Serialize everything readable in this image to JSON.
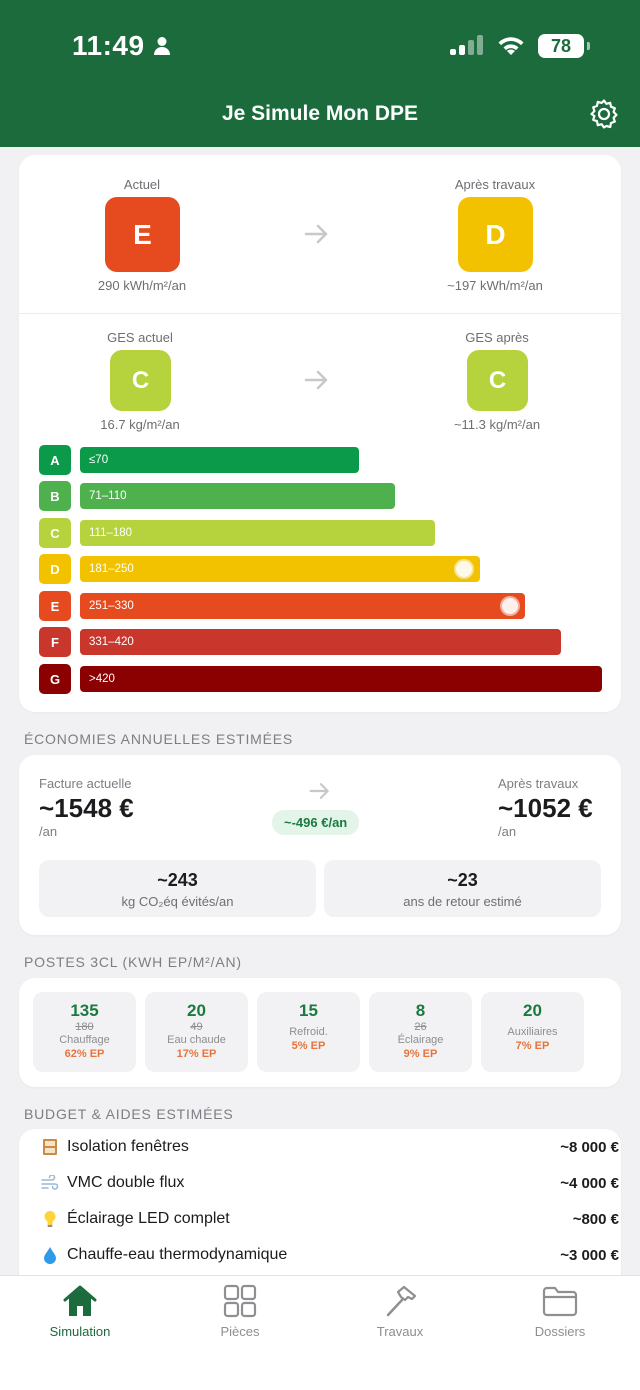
{
  "status_bar": {
    "time": "11:49",
    "battery": "78"
  },
  "header": {
    "title": "Je Simule Mon DPE",
    "settings_icon": "gear-icon"
  },
  "dpe": {
    "current_label": "Actuel",
    "current_class": "E",
    "current_value": "290 kWh/m²/an",
    "after_label": "Après travaux",
    "after_class": "D",
    "after_value": "~197 kWh/m²/an",
    "ges_current_label": "GES actuel",
    "ges_current_class": "C",
    "ges_current_value": "16.7 kg/m²/an",
    "ges_after_label": "GES après",
    "ges_after_class": "C",
    "ges_after_value": "~11.3 kg/m²/an",
    "colors": {
      "E": "#e64a1f",
      "D": "#f2c200",
      "C": "#b6d23c"
    }
  },
  "scale": [
    {
      "letter": "A",
      "range": "≤70",
      "color": "#0b9a4a",
      "fill": 0.5
    },
    {
      "letter": "B",
      "range": "71–110",
      "color": "#4fb14e",
      "fill": 0.56
    },
    {
      "letter": "C",
      "range": "111–180",
      "color": "#b6d23c",
      "fill": 0.63
    },
    {
      "letter": "D",
      "range": "181–250",
      "color": "#f2c200",
      "fill": 0.71
    },
    {
      "letter": "E",
      "range": "251–330",
      "color": "#e64a1f",
      "fill": 0.79
    },
    {
      "letter": "F",
      "range": "331–420",
      "color": "#c9372c",
      "fill": 0.86
    },
    {
      "letter": "G",
      "range": ">420",
      "color": "#8b0000",
      "fill": 0.93
    }
  ],
  "savings": {
    "section_title": "ÉCONOMIES ANNUELLES ESTIMÉES",
    "current_label": "Facture actuelle",
    "current_value": "~1548 €",
    "current_unit": "/an",
    "after_label": "Après travaux",
    "after_value": "~1052 €",
    "after_unit": "/an",
    "delta": "~-496 €/an",
    "co2_value": "~243",
    "co2_label": "kg CO₂éq évités/an",
    "payback_value": "~23",
    "payback_label": "ans de retour estimé"
  },
  "postes": {
    "section_title": "POSTES 3CL (KWH EP/M²/AN)",
    "items": [
      {
        "value": "135",
        "old": "180",
        "name": "Chauffage",
        "ep": "62% EP"
      },
      {
        "value": "20",
        "old": "49",
        "name": "Eau chaude",
        "ep": "17% EP"
      },
      {
        "value": "15",
        "old": "",
        "name": "Refroid.",
        "ep": "5% EP"
      },
      {
        "value": "8",
        "old": "26",
        "name": "Éclairage",
        "ep": "9% EP"
      },
      {
        "value": "20",
        "old": "",
        "name": "Auxiliaires",
        "ep": "7% EP"
      }
    ]
  },
  "budget": {
    "section_title": "BUDGET & AIDES ESTIMÉES",
    "items": [
      {
        "icon": "window-icon",
        "label": "Isolation fenêtres",
        "price": "~8 000 €"
      },
      {
        "icon": "wind-icon",
        "label": "VMC double flux",
        "price": "~4 000 €"
      },
      {
        "icon": "lightbulb-icon",
        "label": "Éclairage LED complet",
        "price": "~800 €"
      },
      {
        "icon": "droplet-icon",
        "label": "Chauffe-eau thermodynamique",
        "price": "~3 000 €"
      }
    ]
  },
  "tabs": [
    {
      "label": "Simulation",
      "icon": "house-icon",
      "active": true
    },
    {
      "label": "Pièces",
      "icon": "grid-icon",
      "active": false
    },
    {
      "label": "Travaux",
      "icon": "hammer-icon",
      "active": false
    },
    {
      "label": "Dossiers",
      "icon": "folder-icon",
      "active": false
    }
  ]
}
